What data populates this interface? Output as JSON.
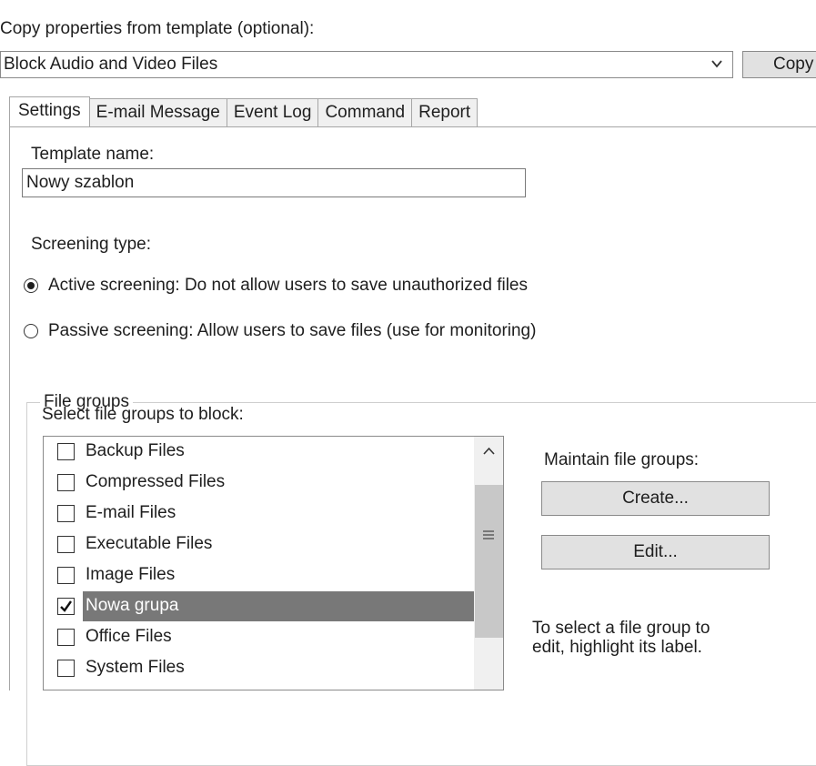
{
  "template_section": {
    "label": "Copy properties from template (optional):",
    "selected": "Block Audio and Video Files",
    "copy_button": "Copy"
  },
  "tabs": [
    {
      "label": "Settings",
      "active": true
    },
    {
      "label": "E-mail Message",
      "active": false
    },
    {
      "label": "Event Log",
      "active": false
    },
    {
      "label": "Command",
      "active": false
    },
    {
      "label": "Report",
      "active": false
    }
  ],
  "settings": {
    "template_name_label": "Template name:",
    "template_name_value": "Nowy szablon",
    "screening_type_label": "Screening type:",
    "active_option": "Active screening: Do not allow users to save unauthorized files",
    "passive_option": "Passive screening: Allow users to save files (use for monitoring)",
    "selected_screening": "active"
  },
  "file_groups": {
    "legend": "File groups",
    "select_label": "Select file groups to block:",
    "items": [
      {
        "label": "Backup Files",
        "checked": false,
        "selected": false
      },
      {
        "label": "Compressed Files",
        "checked": false,
        "selected": false
      },
      {
        "label": "E-mail Files",
        "checked": false,
        "selected": false
      },
      {
        "label": "Executable Files",
        "checked": false,
        "selected": false
      },
      {
        "label": "Image Files",
        "checked": false,
        "selected": false
      },
      {
        "label": "Nowa grupa",
        "checked": true,
        "selected": true
      },
      {
        "label": "Office Files",
        "checked": false,
        "selected": false
      },
      {
        "label": "System Files",
        "checked": false,
        "selected": false
      }
    ],
    "maintain_label": "Maintain file groups:",
    "create_button": "Create...",
    "edit_button": "Edit...",
    "hint_line1": "To select a file group to",
    "hint_line2": "edit, highlight its label."
  },
  "icons": {
    "dropdown": "chevron-down-icon",
    "scroll_up": "chevron-up-icon",
    "scroll_grip": "grip-lines-icon",
    "checkmark": "checkmark-icon"
  },
  "colors": {
    "selection": "#787878",
    "button_face": "#e1e1e1",
    "border": "#8a8a8a"
  }
}
